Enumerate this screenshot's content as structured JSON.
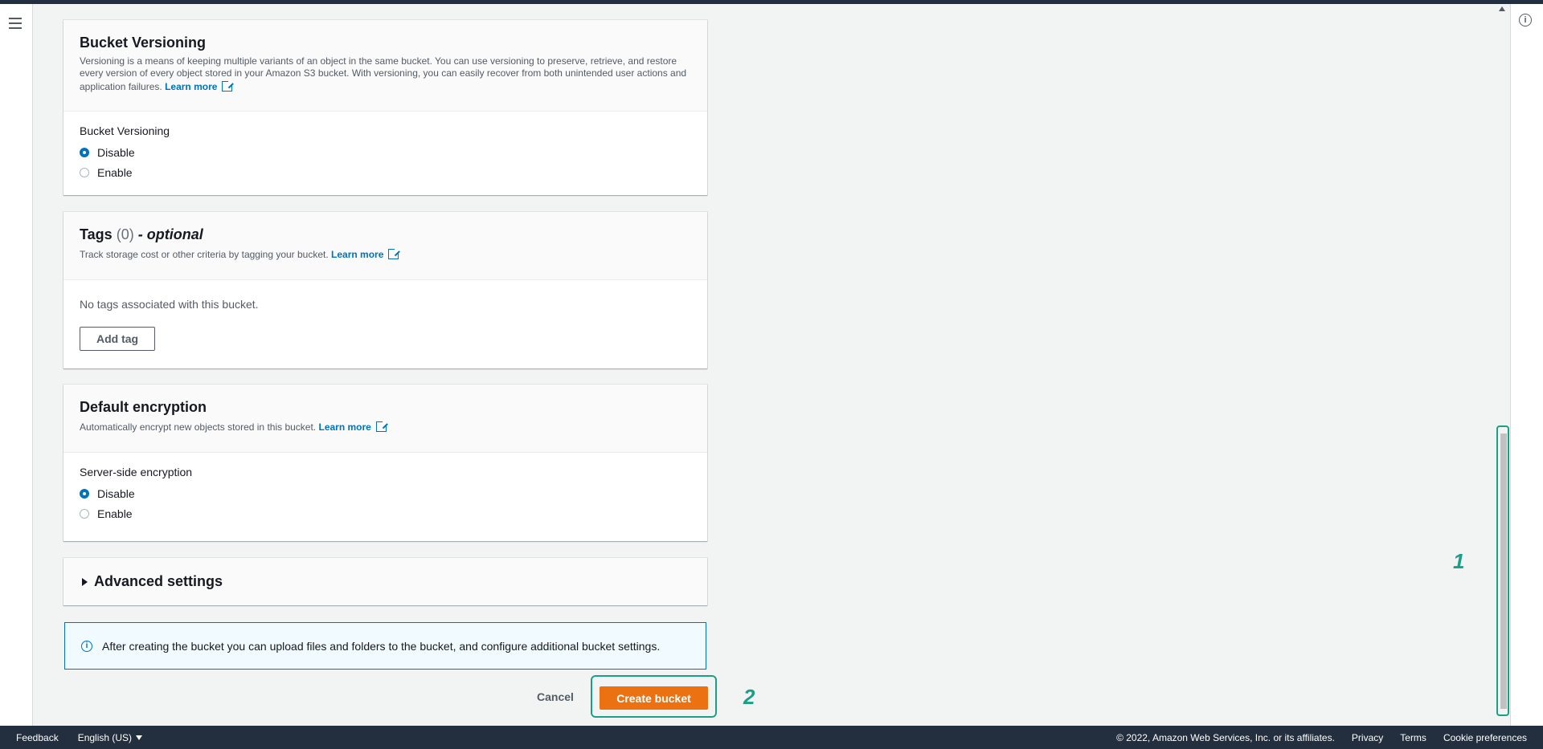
{
  "versioning": {
    "title": "Bucket Versioning",
    "description": "Versioning is a means of keeping multiple variants of an object in the same bucket. You can use versioning to preserve, retrieve, and restore every version of every object stored in your Amazon S3 bucket. With versioning, you can easily recover from both unintended user actions and application failures.",
    "learn_more": "Learn more",
    "field_label": "Bucket Versioning",
    "options": [
      "Disable",
      "Enable"
    ],
    "selected": "Disable"
  },
  "tags": {
    "title": "Tags",
    "count": "(0)",
    "optional": "- optional",
    "description": "Track storage cost or other criteria by tagging your bucket.",
    "learn_more": "Learn more",
    "empty_text": "No tags associated with this bucket.",
    "add_tag_label": "Add tag"
  },
  "encryption": {
    "title": "Default encryption",
    "description": "Automatically encrypt new objects stored in this bucket.",
    "learn_more": "Learn more",
    "field_label": "Server-side encryption",
    "options": [
      "Disable",
      "Enable"
    ],
    "selected": "Disable"
  },
  "advanced": {
    "title": "Advanced settings"
  },
  "info_box": {
    "text": "After creating the bucket you can upload files and folders to the bucket, and configure additional bucket settings."
  },
  "actions": {
    "cancel_label": "Cancel",
    "create_label": "Create bucket"
  },
  "annotations": {
    "marker_1": "1",
    "marker_2": "2"
  },
  "footer": {
    "feedback": "Feedback",
    "language": "English (US)",
    "copyright": "© 2022, Amazon Web Services, Inc. or its affiliates.",
    "privacy": "Privacy",
    "terms": "Terms",
    "cookies": "Cookie preferences"
  },
  "colors": {
    "primary_button": "#ec7211",
    "link": "#0073bb",
    "annotation": "#1ba085",
    "footer_bg": "#232f3e"
  },
  "icons": [
    "menu-icon",
    "info-icon",
    "external-link-icon",
    "caret-right-icon",
    "caret-down-icon"
  ]
}
